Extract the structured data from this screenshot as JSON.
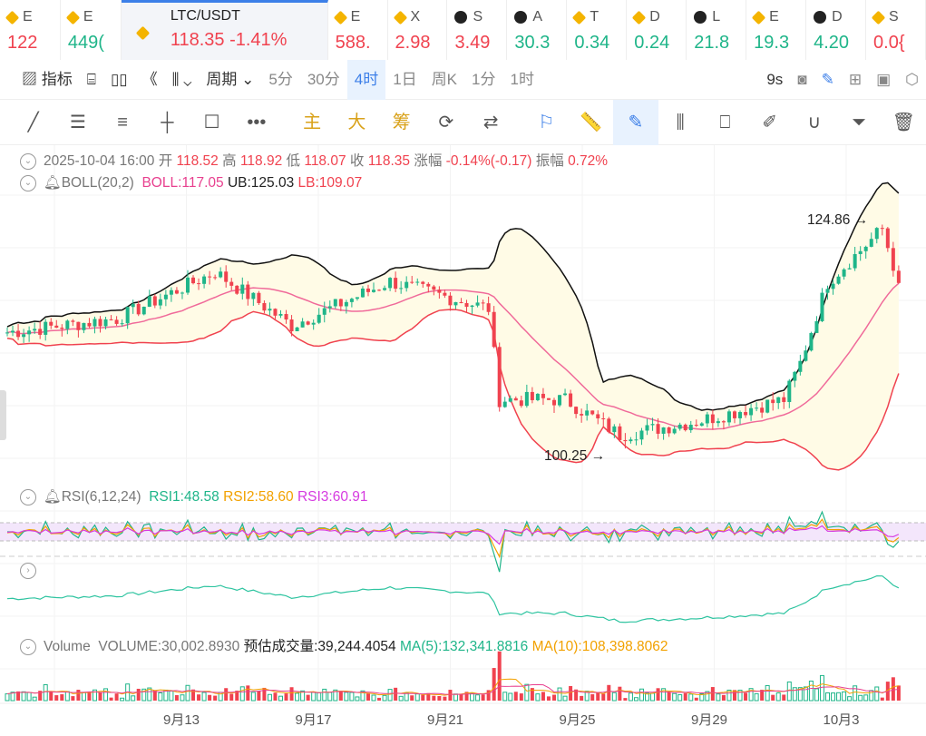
{
  "tickers": [
    {
      "sym": "E",
      "price": "122",
      "color": "red",
      "icon": "binance-icon"
    },
    {
      "sym": "E",
      "price": "449(",
      "color": "green",
      "icon": "binance-icon"
    },
    {
      "sym": "LTC/USDT",
      "price": "118.35",
      "change": "-1.41%",
      "color": "red",
      "icon": "binance-icon",
      "active": true
    },
    {
      "sym": "E",
      "price": "588.",
      "color": "red",
      "icon": "binance-icon"
    },
    {
      "sym": "X",
      "price": "2.98",
      "color": "red",
      "icon": "binance-icon"
    },
    {
      "sym": "S",
      "price": "3.49",
      "color": "red",
      "icon": "okx-icon"
    },
    {
      "sym": "A",
      "price": "30.3",
      "color": "green",
      "icon": "okx-icon"
    },
    {
      "sym": "T",
      "price": "0.34",
      "color": "green",
      "icon": "binance-icon"
    },
    {
      "sym": "D",
      "price": "0.24",
      "color": "green",
      "icon": "binance-icon"
    },
    {
      "sym": "L",
      "price": "21.8",
      "color": "green",
      "icon": "okx-icon"
    },
    {
      "sym": "E",
      "price": "19.3",
      "color": "green",
      "icon": "binance-icon"
    },
    {
      "sym": "D",
      "price": "4.20",
      "color": "green",
      "icon": "okx-icon"
    },
    {
      "sym": "S",
      "price": "0.0{",
      "color": "red",
      "icon": "binance-icon"
    }
  ],
  "toolbar": {
    "indicators": "指标",
    "period": "周期",
    "intervals": [
      "5分",
      "30分",
      "4时",
      "1日",
      "周K",
      "1分",
      "1时"
    ],
    "selected_interval": "4时",
    "countdown": "9s"
  },
  "drawing_tools": {
    "main": "主",
    "big": "大",
    "chip": "筹"
  },
  "info": {
    "datetime": "2025-10-04 16:00",
    "open_label": "开",
    "open": "118.52",
    "high_label": "高",
    "high": "118.92",
    "low_label": "低",
    "low": "118.07",
    "close_label": "收",
    "close": "118.35",
    "change_label": "涨幅",
    "change": "-0.14%(-0.17)",
    "amp_label": "振幅",
    "amp": "0.72%"
  },
  "boll": {
    "label": "BOLL(20,2)",
    "boll": "BOLL:117.05",
    "ub": "UB:125.03",
    "lb": "LB:109.07"
  },
  "rsi": {
    "label": "RSI(6,12,24)",
    "rsi1": "RSI1:48.58",
    "rsi2": "RSI2:58.60",
    "rsi3": "RSI3:60.91"
  },
  "volume": {
    "label": "Volume",
    "vol": "VOLUME:30,002.8930",
    "est": "预估成交量:39,244.4054",
    "ma5": "MA(5):132,341.8816",
    "ma10": "MA(10):108,398.8062"
  },
  "chart_data": {
    "type": "candlestick",
    "high_marker": "124.86",
    "low_marker": "100.25",
    "price_range": [
      98,
      127
    ],
    "anchors": [
      [
        0,
        113.2
      ],
      [
        20,
        114.6
      ],
      [
        38,
        119.5
      ],
      [
        52,
        113.9
      ],
      [
        70,
        118.5
      ],
      [
        88,
        115.7
      ],
      [
        90,
        106.2
      ],
      [
        102,
        106.2
      ],
      [
        112,
        102.5
      ],
      [
        126,
        103.9
      ],
      [
        142,
        106.2
      ],
      [
        145,
        110
      ],
      [
        150,
        118.4
      ],
      [
        160,
        124
      ],
      [
        163,
        118.35
      ]
    ],
    "x_labels": [
      "9月13",
      "9月17",
      "9月21",
      "9月25",
      "9月29",
      "10月3"
    ],
    "colors": {
      "up": "#1fb589",
      "down": "#f0424f",
      "ub": "#111111",
      "mid": "#f06a9a",
      "lb": "#f0424f",
      "band": "#fffbe6"
    }
  }
}
